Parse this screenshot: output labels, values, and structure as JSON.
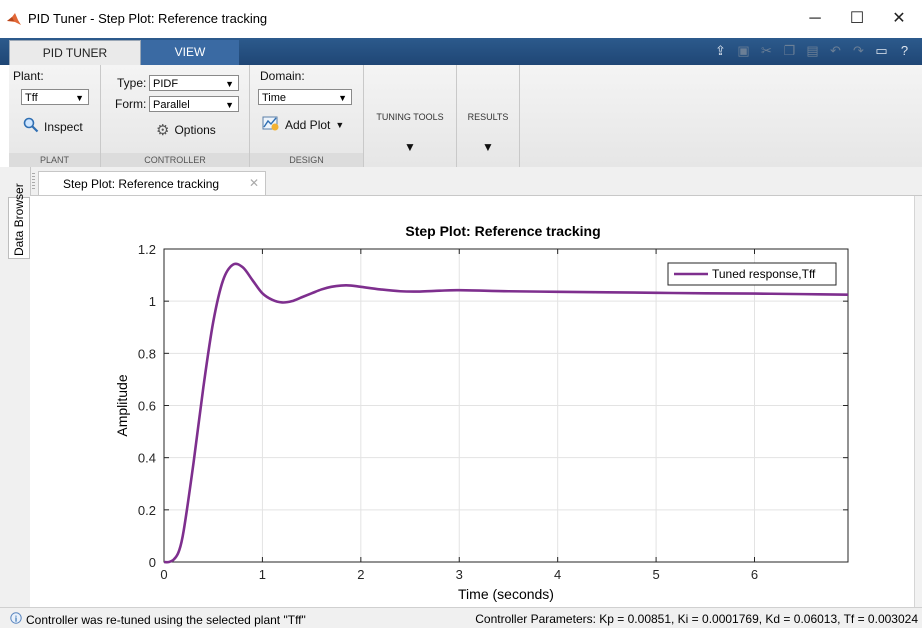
{
  "window": {
    "title": "PID Tuner - Step Plot: Reference tracking",
    "min_glyph": "─",
    "max_glyph": "☐",
    "close_glyph": "✕"
  },
  "tabs": {
    "pid_tuner": "PID TUNER",
    "view": "VIEW"
  },
  "ribbon": {
    "plant": {
      "label": "Plant:",
      "value": "Tff",
      "inspect": "Inspect",
      "footer": "PLANT"
    },
    "controller": {
      "type_label": "Type:",
      "type_value": "PIDF",
      "form_label": "Form:",
      "form_value": "Parallel",
      "options": "Options",
      "footer": "CONTROLLER"
    },
    "design": {
      "domain_label": "Domain:",
      "domain_value": "Time",
      "add_plot": "Add Plot",
      "footer": "DESIGN"
    },
    "tuning_tools": "TUNING TOOLS",
    "results": "RESULTS"
  },
  "document_tab": "Step Plot: Reference tracking",
  "side_tab": "Data Browser",
  "chart_data": {
    "type": "line",
    "title": "Step Plot: Reference tracking",
    "xlabel": "Time (seconds)",
    "ylabel": "Amplitude",
    "xlim": [
      0,
      6.95
    ],
    "ylim": [
      0,
      1.2
    ],
    "xticks": [
      "0",
      "1",
      "2",
      "3",
      "4",
      "5",
      "6"
    ],
    "yticks": [
      "0",
      "0.2",
      "0.4",
      "0.6",
      "0.8",
      "1",
      "1.2"
    ],
    "grid": true,
    "legend_position": "top-right",
    "series": [
      {
        "name": "Tuned response,Tff",
        "color": "#7e2f8e",
        "x": [
          0,
          0.05,
          0.1,
          0.15,
          0.2,
          0.3,
          0.4,
          0.5,
          0.6,
          0.7,
          0.8,
          0.9,
          1.0,
          1.1,
          1.2,
          1.3,
          1.4,
          1.5,
          1.6,
          1.7,
          1.8,
          1.9,
          2.0,
          2.2,
          2.4,
          2.6,
          2.8,
          3.0,
          3.5,
          4.0,
          4.5,
          5.0,
          5.5,
          6.0,
          6.5,
          6.95
        ],
        "y": [
          0,
          0.0,
          0.01,
          0.04,
          0.12,
          0.38,
          0.67,
          0.92,
          1.08,
          1.14,
          1.13,
          1.08,
          1.03,
          1.005,
          0.995,
          1.0,
          1.015,
          1.03,
          1.045,
          1.055,
          1.06,
          1.06,
          1.055,
          1.045,
          1.038,
          1.037,
          1.04,
          1.042,
          1.038,
          1.036,
          1.034,
          1.032,
          1.03,
          1.029,
          1.027,
          1.025
        ]
      }
    ]
  },
  "status": {
    "left": "Controller was re-tuned using the selected plant \"Tff\"",
    "right": "Controller Parameters: Kp = 0.00851, Ki = 0.0001769, Kd = 0.06013, Tf = 0.003024"
  }
}
